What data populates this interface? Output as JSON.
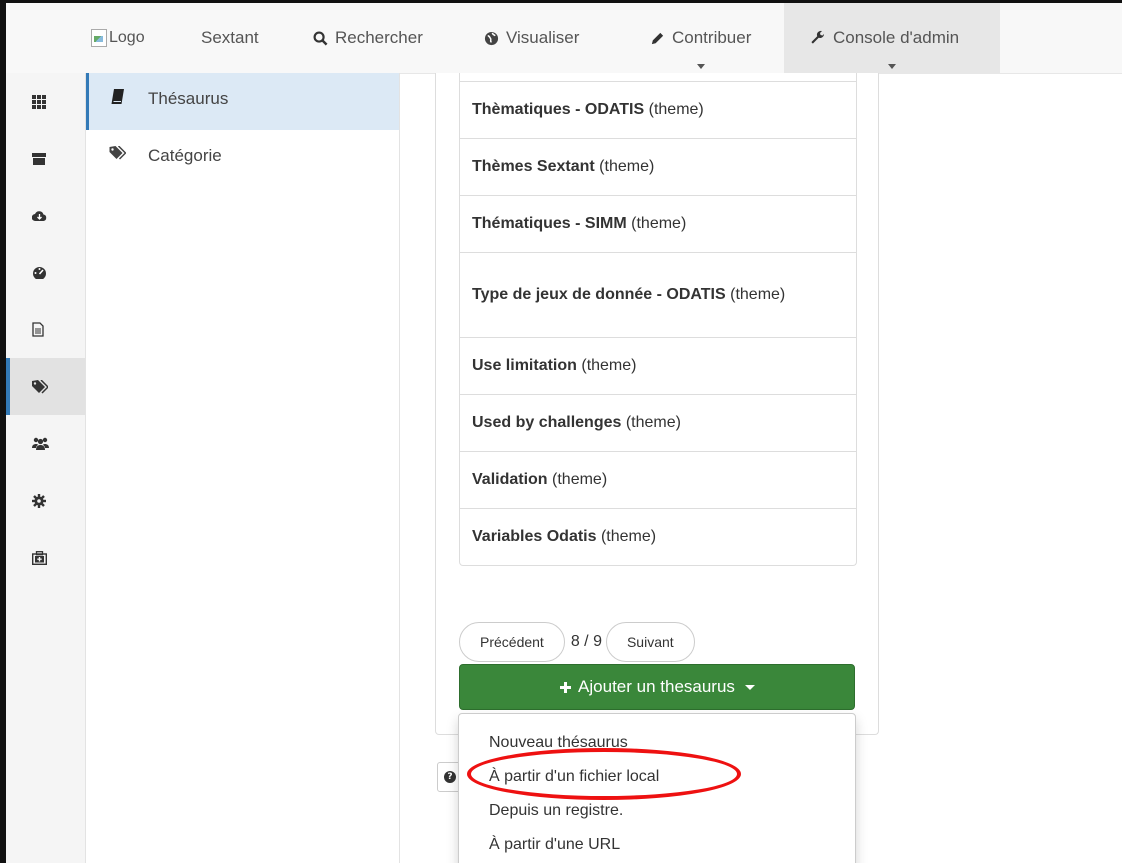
{
  "topnav": {
    "logo_alt": "Logo",
    "items": [
      "Sextant",
      "Rechercher",
      "Visualiser",
      "Contribuer",
      "Console d'admin"
    ]
  },
  "submenu": {
    "items": [
      {
        "label": "Thésaurus",
        "icon": "book-icon",
        "active": true
      },
      {
        "label": "Catégorie",
        "icon": "tags-icon",
        "active": false
      }
    ]
  },
  "rail": {
    "icons": [
      "grid-icon",
      "archive-icon",
      "cloud-icon",
      "dashboard-icon",
      "file-icon",
      "tags-icon",
      "users-icon",
      "gear-icon",
      "toolbox-icon"
    ],
    "active_index": 5
  },
  "thesaurus_list": [
    {
      "name": "Thèmatiques - ODATIS",
      "type": "(theme)"
    },
    {
      "name": "Thèmes Sextant",
      "type": "(theme)"
    },
    {
      "name": "Thématiques - SIMM",
      "type": "(theme)"
    },
    {
      "name": "Type de jeux de donnée - ODATIS",
      "type": "(theme)"
    },
    {
      "name": "Use limitation",
      "type": "(theme)"
    },
    {
      "name": "Used by challenges",
      "type": "(theme)"
    },
    {
      "name": "Validation",
      "type": "(theme)"
    },
    {
      "name": "Variables Odatis",
      "type": "(theme)"
    }
  ],
  "pager": {
    "prev": "Précédent",
    "current": "8 / 9",
    "next": "Suivant"
  },
  "add_button": {
    "label": "Ajouter un thesaurus"
  },
  "dropdown": {
    "items": [
      "Nouveau thésaurus",
      "À partir d'un fichier local",
      "Depuis un registre.",
      "À partir d'une URL"
    ]
  },
  "colors": {
    "accent": "#337ab7",
    "success": "#3a873a",
    "highlight": "#e11111"
  }
}
